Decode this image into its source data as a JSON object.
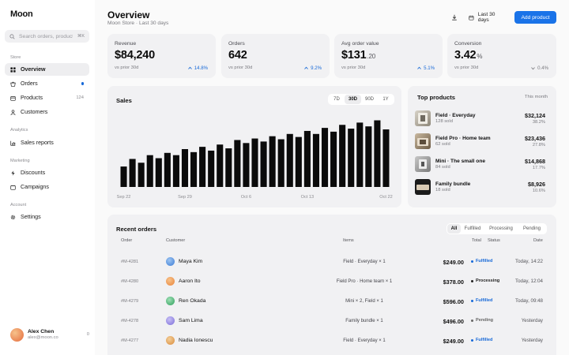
{
  "app": {
    "name": "Moon"
  },
  "search": {
    "placeholder": "Search orders, products",
    "shortcut": "⌘K"
  },
  "sidebar": {
    "sections": {
      "store": "Store",
      "analytics": "Analytics",
      "marketing": "Marketing",
      "account": "Account"
    },
    "items": [
      {
        "label": "Overview",
        "icon": "home-icon",
        "active": true
      },
      {
        "label": "Orders",
        "icon": "orders-icon",
        "badge": "dot"
      },
      {
        "label": "Products",
        "icon": "products-icon",
        "count": "124"
      },
      {
        "label": "Customers",
        "icon": "customers-icon"
      },
      {
        "label": "Sales reports",
        "icon": "chart-icon"
      },
      {
        "label": "Discounts",
        "icon": "discount-icon"
      },
      {
        "label": "Campaigns",
        "icon": "campaign-icon"
      },
      {
        "label": "Settings",
        "icon": "gear-icon"
      }
    ],
    "user": {
      "name": "Alex Chen",
      "email": "alex@moon.co",
      "count": "0"
    }
  },
  "header": {
    "title": "Overview",
    "subtitle": "Moon Store · Last 30 days",
    "date_range": "Last 30 days",
    "add_product": "Add product"
  },
  "kpis": [
    {
      "label": "Revenue",
      "value": "$84,240",
      "unit": "",
      "prior": "vs prior 30d",
      "change": "14.8%",
      "direction": "up"
    },
    {
      "label": "Orders",
      "value": "642",
      "unit": "",
      "prior": "vs prior 30d",
      "change": "9.2%",
      "direction": "up"
    },
    {
      "label": "Avg order value",
      "value": "$131",
      "unit": ".20",
      "prior": "vs prior 30d",
      "change": "5.1%",
      "direction": "up"
    },
    {
      "label": "Conversion",
      "value": "3.42",
      "unit": "%",
      "prior": "vs prior 30d",
      "change": "0.4%",
      "direction": "down"
    }
  ],
  "sales": {
    "title": "Sales",
    "ranges": [
      "7D",
      "30D",
      "90D",
      "1Y"
    ],
    "active_range": "30D"
  },
  "chart_data": {
    "type": "bar",
    "title": "Sales",
    "xlabel": "",
    "ylabel": "",
    "grid": false,
    "x_tick_labels": [
      "Sep 22",
      "Sep 29",
      "Oct 6",
      "Oct 13",
      "Oct 22"
    ],
    "values": [
      27,
      37,
      32,
      42,
      38,
      45,
      42,
      50,
      46,
      53,
      48,
      56,
      51,
      62,
      58,
      64,
      60,
      67,
      63,
      70,
      66,
      74,
      70,
      78,
      73,
      82,
      77,
      85,
      80,
      88,
      76
    ],
    "ylim": [
      0,
      100
    ],
    "color": "#0b0b0b"
  },
  "top_products": {
    "title": "Top products",
    "period": "This month",
    "items": [
      {
        "name": "Field · Everyday",
        "sold": "128 sold",
        "revenue": "$32,124",
        "share": "38.2%"
      },
      {
        "name": "Field Pro · Home team",
        "sold": "62 sold",
        "revenue": "$23,436",
        "share": "27.8%"
      },
      {
        "name": "Mini · The small one",
        "sold": "84 sold",
        "revenue": "$14,868",
        "share": "17.7%"
      },
      {
        "name": "Family bundle",
        "sold": "18 sold",
        "revenue": "$8,926",
        "share": "10.6%"
      }
    ]
  },
  "orders": {
    "title": "Recent orders",
    "filters": [
      "All",
      "Fulfilled",
      "Processing",
      "Pending"
    ],
    "active_filter": "All",
    "columns": {
      "order": "Order",
      "customer": "Customer",
      "items": "Items",
      "total": "Total",
      "status": "Status",
      "date": "Date"
    },
    "rows": [
      {
        "id": "#M-4281",
        "customer": "Maya Kim",
        "items": "Field · Everyday × 1",
        "total": "$249.00",
        "status": "Fulfilled",
        "date": "Today, 14:22",
        "avatar_color": "#3a7bd5"
      },
      {
        "id": "#M-4280",
        "customer": "Aaron Ito",
        "items": "Field Pro · Home team × 1",
        "total": "$378.00",
        "status": "Processing",
        "date": "Today, 12:04",
        "avatar_color": "#e9833a"
      },
      {
        "id": "#M-4279",
        "customer": "Ren Okada",
        "items": "Mini × 2, Field × 1",
        "total": "$596.00",
        "status": "Fulfilled",
        "date": "Today, 09:48",
        "avatar_color": "#2e9e5b"
      },
      {
        "id": "#M-4278",
        "customer": "Sam Lima",
        "items": "Family bundle × 1",
        "total": "$496.00",
        "status": "Pending",
        "date": "Yesterday",
        "avatar_color": "#7b6cd9"
      },
      {
        "id": "#M-4277",
        "customer": "Nadia Ionescu",
        "items": "Field · Everyday × 1",
        "total": "$249.00",
        "status": "Fulfilled",
        "date": "Yesterday",
        "avatar_color": "#d98a3a"
      }
    ]
  }
}
